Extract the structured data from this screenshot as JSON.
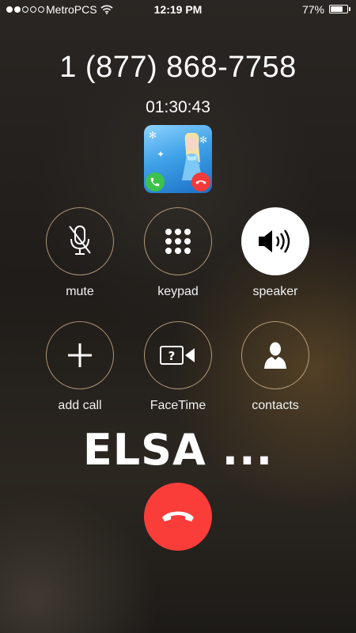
{
  "status_bar": {
    "signal_bars_filled": 2,
    "signal_bars_total": 5,
    "carrier": "MetroPCS",
    "wifi_icon": "wifi-icon",
    "time": "12:19 PM",
    "battery_percent": "77%",
    "battery_level": 0.77
  },
  "call": {
    "number": "1 (877) 868-7758",
    "duration": "01:30:43"
  },
  "buttons": {
    "mute": {
      "label": "mute",
      "icon": "mic-muted-icon",
      "active": false
    },
    "keypad": {
      "label": "keypad",
      "icon": "keypad-icon",
      "active": false
    },
    "speaker": {
      "label": "speaker",
      "icon": "speaker-icon",
      "active": true
    },
    "add_call": {
      "label": "add call",
      "icon": "plus-icon",
      "active": false
    },
    "facetime": {
      "label": "FaceTime",
      "icon": "facetime-icon",
      "active": false
    },
    "contacts": {
      "label": "contacts",
      "icon": "contacts-icon",
      "active": false
    }
  },
  "caption": "ELSA ...",
  "colors": {
    "end_call": "#fb3d3a",
    "accept_green": "#3cc24a",
    "ring_border": "#dcbe96"
  }
}
